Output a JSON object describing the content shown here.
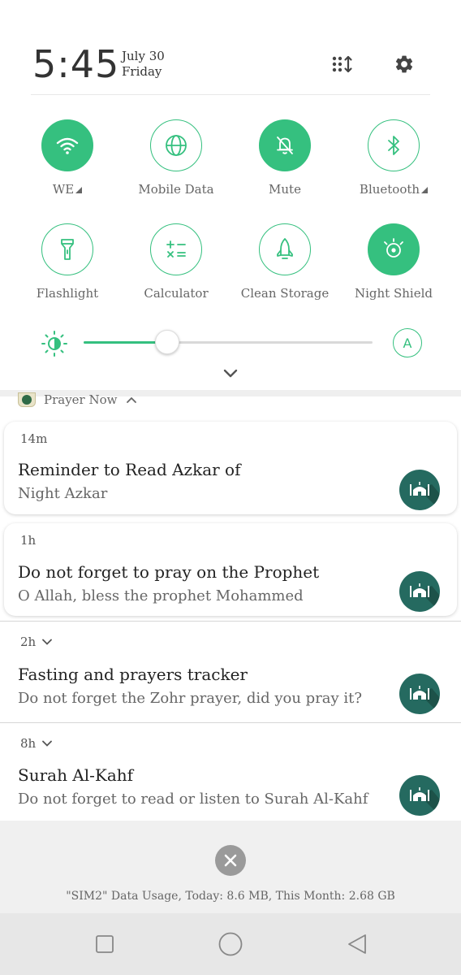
{
  "status": {
    "time": "5:45",
    "date": "July 30",
    "day": "Friday",
    "edit_icon": "grid-sort-icon",
    "settings_icon": "gear-icon"
  },
  "tiles": [
    {
      "label": "WE",
      "icon": "wifi-icon",
      "active": true,
      "expand": true
    },
    {
      "label": "Mobile Data",
      "icon": "globe-icon",
      "active": false,
      "expand": false
    },
    {
      "label": "Mute",
      "icon": "bell-off-icon",
      "active": true,
      "expand": false
    },
    {
      "label": "Bluetooth",
      "icon": "bluetooth-icon",
      "active": false,
      "expand": true
    },
    {
      "label": "Flashlight",
      "icon": "flashlight-icon",
      "active": false,
      "expand": false
    },
    {
      "label": "Calculator",
      "icon": "calculator-icon",
      "active": false,
      "expand": false
    },
    {
      "label": "Clean Storage",
      "icon": "rocket-icon",
      "active": false,
      "expand": false
    },
    {
      "label": "Night Shield",
      "icon": "eye-icon",
      "active": true,
      "expand": false
    }
  ],
  "brightness": {
    "level": 0.29,
    "auto_label": "A"
  },
  "app": {
    "name": "Prayer Now"
  },
  "notifications": [
    {
      "time": "14m",
      "title": "Reminder to Read Azkar of",
      "text": "Night Azkar"
    },
    {
      "time": "1h",
      "title": "Do not forget to pray on the Prophet",
      "text": "O Allah, bless the prophet Mohammed"
    },
    {
      "time": "2h",
      "title": "Fasting and prayers tracker",
      "text": "Do not forget the Zohr  prayer, did you pray it?"
    },
    {
      "time": "8h",
      "title": "Surah Al-Kahf",
      "text": "Do not forget to read or listen to Surah Al-Kahf"
    }
  ],
  "footer": {
    "data_usage": "\"SIM2\" Data Usage, Today: 8.6 MB, This Month: 2.68 GB"
  },
  "colors": {
    "accent": "#35c07f",
    "notification_icon": "#256a60"
  }
}
